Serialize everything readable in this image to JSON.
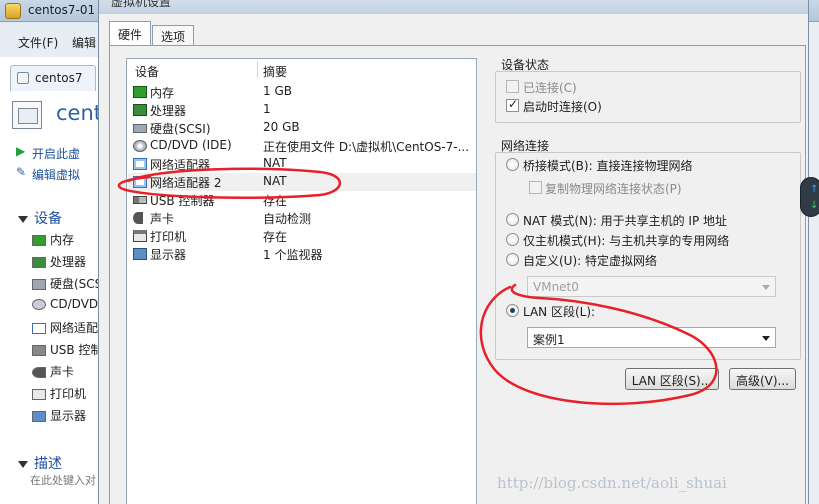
{
  "bg_window": {
    "title": "centos7-01",
    "menu": [
      "文件(F)",
      "编辑"
    ],
    "tab_label": "centos7",
    "vm_name": "cent",
    "actions": [
      "开启此虚",
      "编辑虚拟"
    ],
    "devices_section": "设备",
    "devices": [
      "内存",
      "处理器",
      "硬盘(SCSI)",
      "CD/DVD",
      "网络适配",
      "USB 控制",
      "声卡",
      "打印机",
      "显示器"
    ],
    "description_section": "描述",
    "description_placeholder": "在此处键入对"
  },
  "dialog": {
    "title": "虚拟机设置",
    "tabs": [
      "硬件",
      "选项"
    ],
    "device_list": {
      "columns": [
        "设备",
        "摘要"
      ],
      "rows": [
        {
          "icon": "memory-icon",
          "name": "内存",
          "summary": "1 GB"
        },
        {
          "icon": "processor-icon",
          "name": "处理器",
          "summary": "1"
        },
        {
          "icon": "hard-disk-icon",
          "name": "硬盘(SCSI)",
          "summary": "20 GB"
        },
        {
          "icon": "cd-dvd-icon",
          "name": "CD/DVD (IDE)",
          "summary": "正在使用文件 D:\\虚拟机\\CentOS-7-..."
        },
        {
          "icon": "network-adapter-icon",
          "name": "网络适配器",
          "summary": "NAT"
        },
        {
          "icon": "network-adapter-icon",
          "name": "网络适配器 2",
          "summary": "NAT"
        },
        {
          "icon": "usb-controller-icon",
          "name": "USB 控制器",
          "summary": "存在"
        },
        {
          "icon": "sound-card-icon",
          "name": "声卡",
          "summary": "自动检测"
        },
        {
          "icon": "printer-icon",
          "name": "打印机",
          "summary": "存在"
        },
        {
          "icon": "display-icon",
          "name": "显示器",
          "summary": "1 个监视器"
        }
      ],
      "selected_index": 5
    },
    "device_status": {
      "title": "设备状态",
      "connected_label": "已连接(C)",
      "connected": false,
      "connect_at_power_on_label": "启动时连接(O)",
      "connect_at_power_on": true
    },
    "network_connection": {
      "title": "网络连接",
      "bridged_label": "桥接模式(B): 直接连接物理网络",
      "replicate_label": "复制物理网络连接状态(P)",
      "nat_label": "NAT 模式(N): 用于共享主机的 IP 地址",
      "host_only_label": "仅主机模式(H): 与主机共享的专用网络",
      "custom_label": "自定义(U): 特定虚拟网络",
      "custom_value": "VMnet0",
      "lan_segment_label": "LAN 区段(L):",
      "lan_segment_value": "案例1",
      "selected": "lan_segment"
    },
    "buttons": {
      "lan_segments": "LAN 区段(S)...",
      "advanced": "高级(V)..."
    }
  },
  "watermark": "http://blog.csdn.net/aoli_shuai",
  "annotation_color": "#e8202a"
}
